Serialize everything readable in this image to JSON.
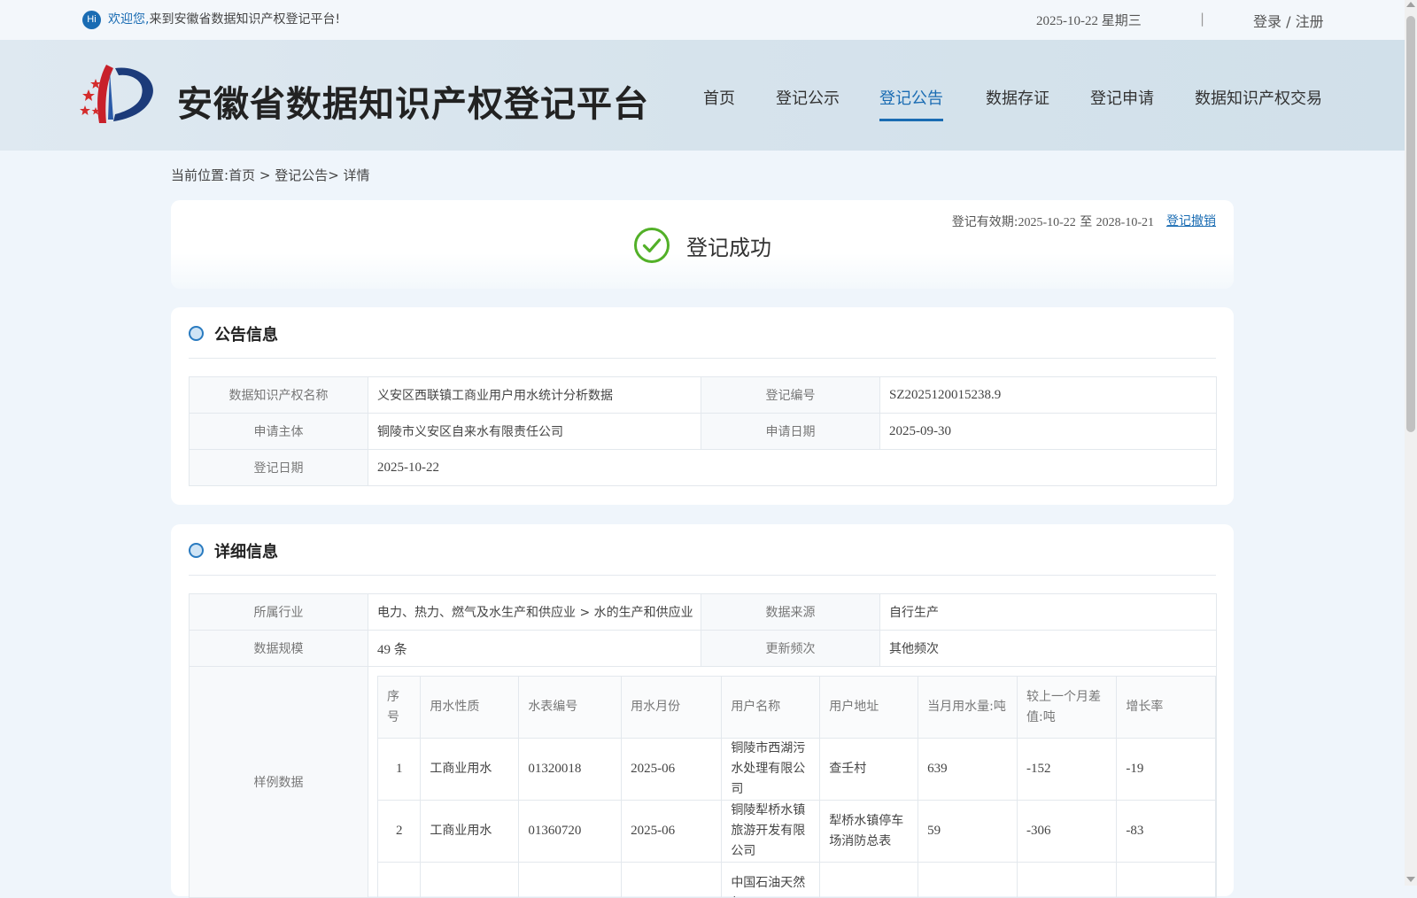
{
  "topbar": {
    "hi_badge": "Hi",
    "welcome_highlight": "欢迎您,",
    "welcome_rest": "来到安徽省数据知识产权登记平台!",
    "date": "2025-10-22 星期三",
    "separator": "|",
    "login": "登录",
    "auth_sep": " / ",
    "register": "注册"
  },
  "header": {
    "site_title": "安徽省数据知识产权登记平台",
    "nav": [
      {
        "label": "首页",
        "active": false
      },
      {
        "label": "登记公示",
        "active": false
      },
      {
        "label": "登记公告",
        "active": true
      },
      {
        "label": "数据存证",
        "active": false
      },
      {
        "label": "登记申请",
        "active": false
      },
      {
        "label": "数据知识产权交易",
        "active": false
      }
    ]
  },
  "breadcrumb": {
    "prefix": "当前位置:",
    "home": "首页",
    "sep1": " > ",
    "section": "登记公告",
    "sep2": "> ",
    "current": "详情"
  },
  "status": {
    "text": "登记成功",
    "validity_label": "登记有效期:",
    "validity_from": "2025-10-22",
    "validity_to_word": " 至 ",
    "validity_to": "2028-10-21",
    "revoke": "登记撤销",
    "success_color": "#52b028"
  },
  "announcement": {
    "title": "公告信息",
    "name_label": "数据知识产权名称",
    "name_value": "义安区西联镇工商业用户用水统计分析数据",
    "reg_no_label": "登记编号",
    "reg_no_value": "SZ2025120015238.9",
    "applicant_label": "申请主体",
    "applicant_value": "铜陵市义安区自来水有限责任公司",
    "apply_date_label": "申请日期",
    "apply_date_value": "2025-09-30",
    "reg_date_label": "登记日期",
    "reg_date_value": "2025-10-22"
  },
  "detail": {
    "title": "详细信息",
    "industry_label": "所属行业",
    "industry_value": "电力、热力、燃气及水生产和供应业 > 水的生产和供应业",
    "source_label": "数据来源",
    "source_value": "自行生产",
    "scale_label": "数据规模",
    "scale_value": "49 条",
    "freq_label": "更新频次",
    "freq_value": "其他频次",
    "sample_label": "样例数据",
    "sample_headers": [
      "序号",
      "用水性质",
      "水表编号",
      "用水月份",
      "用户名称",
      "用户地址",
      "当月用水量:吨",
      "较上一个月差值:吨",
      "增长率"
    ],
    "sample_rows": [
      [
        "1",
        "工商业用水",
        "01320018",
        "2025-06",
        "铜陵市西湖污水处理有限公司",
        "查壬村",
        "639",
        "-152",
        "-19"
      ],
      [
        "2",
        "工商业用水",
        "01360720",
        "2025-06",
        "铜陵犁桥水镇旅游开发有限公司",
        "犁桥水镇停车场消防总表",
        "59",
        "-306",
        "-83"
      ],
      [
        "",
        "",
        "",
        "",
        "中国石油天然气",
        "",
        "",
        "",
        ""
      ]
    ]
  }
}
